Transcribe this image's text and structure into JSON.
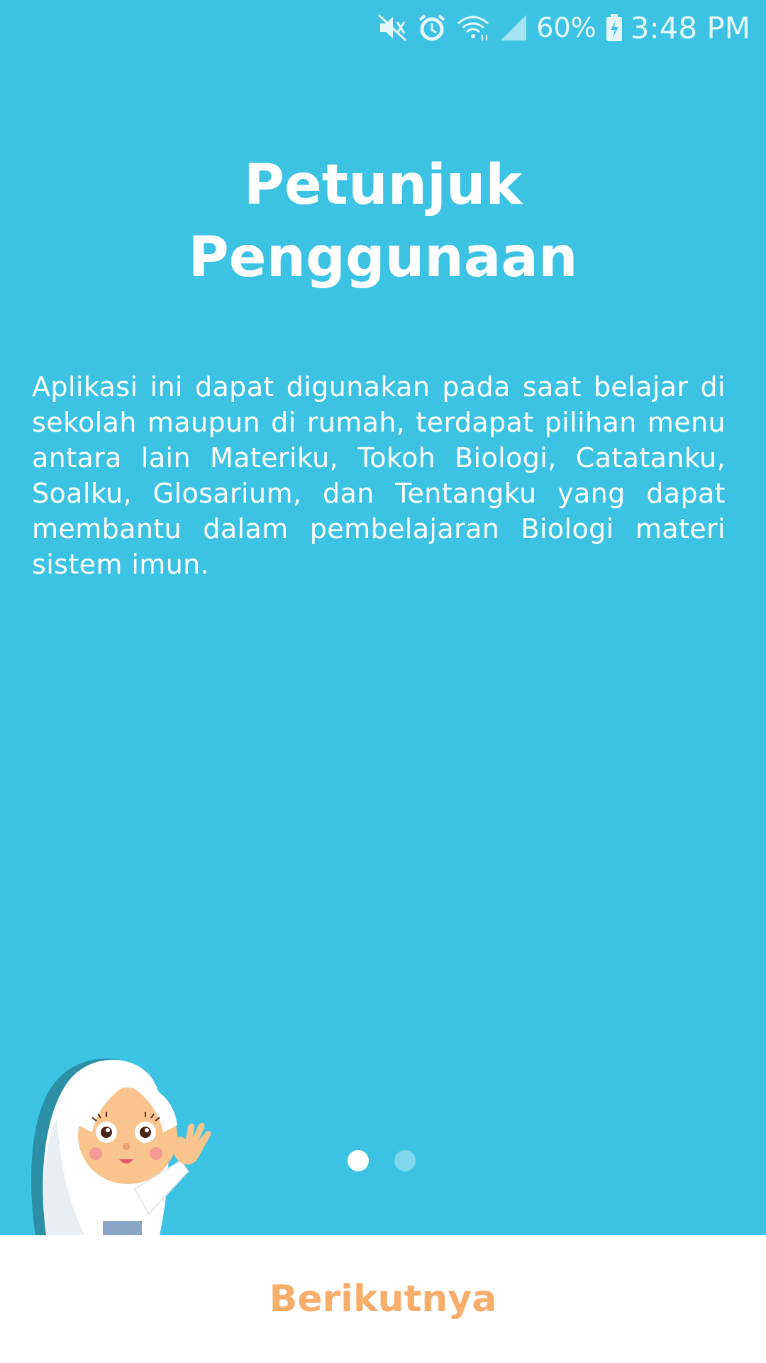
{
  "status_bar": {
    "icons": [
      "mute-icon",
      "alarm-icon",
      "wifi-icon",
      "signal-icon",
      "battery-charging-icon"
    ],
    "battery_percent": "60%",
    "time": "3:48 PM"
  },
  "intro": {
    "title_line1": "Petunjuk",
    "title_line2": "Penggunaan",
    "description": "Aplikasi ini dapat digunakan pada saat belajar di sekolah maupun di rumah, terdapat pilihan menu antara lain Materiku, Tokoh Biologi, Catatanku, Soalku, Glosarium, dan Tentangku yang dapat membantu dalam pembelajaran Biologi materi sistem imun."
  },
  "pager": {
    "current_page": 1,
    "total_pages": 2
  },
  "footer": {
    "next_label": "Berikutnya"
  },
  "colors": {
    "background": "#3cc3e4",
    "button_text": "#f8ad6a",
    "footer_background": "#ffffff"
  }
}
